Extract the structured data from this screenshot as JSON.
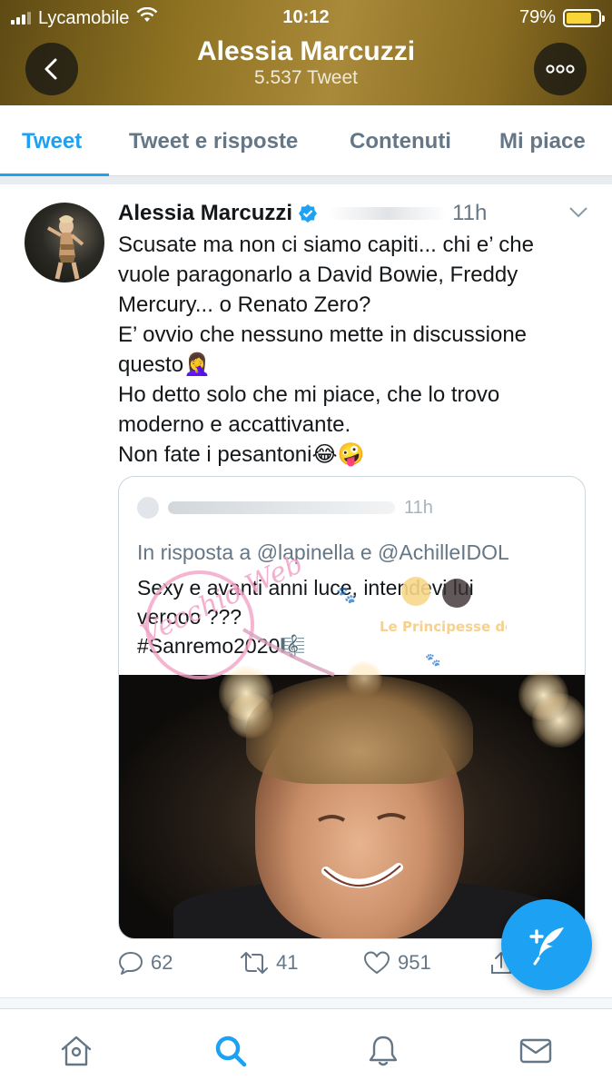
{
  "status_bar": {
    "carrier": "Lycamobile",
    "time": "10:12",
    "battery_percent": "79%",
    "battery_level": 0.79,
    "battery_color": "#f7d63a"
  },
  "header": {
    "back_icon": "chevron-left-icon",
    "title": "Alessia Marcuzzi",
    "subtitle": "5.537 Tweet",
    "more_icon": "ellipsis-icon"
  },
  "tabs": [
    {
      "label": "Tweet",
      "active": true
    },
    {
      "label": "Tweet e risposte",
      "active": false
    },
    {
      "label": "Contenuti",
      "active": false
    },
    {
      "label": "Mi piace",
      "active": false
    }
  ],
  "tweet": {
    "author": "Alessia Marcuzzi",
    "verified": true,
    "time": "11h",
    "text_lines": [
      "Scusate ma non ci siamo capiti... chi e’ che",
      "vuole paragonarlo a David Bowie, Freddy",
      "Mercury... o Renato Zero?",
      "E’ ovvio che nessuno mette in discussione",
      "questo🤦‍♀️",
      "Ho detto solo che mi piace, che lo trovo",
      "moderno e accattivante.",
      "Non fate i pesantoni😂🤪"
    ],
    "quote": {
      "time": "11h",
      "reply_to_prefix": "In risposta a",
      "reply_to_user1": "@lapinella",
      "reply_to_and": "e",
      "reply_to_user2": "@AchilleIDOL",
      "text_lines": [
        "Sexy e avanti anni luce, intendevi lui",
        "verooo ???",
        "#Sanremo2020🎼"
      ]
    },
    "actions": {
      "replies": "62",
      "retweets": "41",
      "likes": "951"
    }
  },
  "watermark": {
    "left_text": "Vecchio Web",
    "right_text": "Le Principesse del Web"
  },
  "colors": {
    "accent": "#1da1f2",
    "muted": "#657786",
    "header_gold": "#a9893a"
  },
  "bottom_nav": [
    {
      "icon": "home-icon"
    },
    {
      "icon": "search-icon",
      "active": true
    },
    {
      "icon": "bell-icon"
    },
    {
      "icon": "mail-icon"
    }
  ]
}
